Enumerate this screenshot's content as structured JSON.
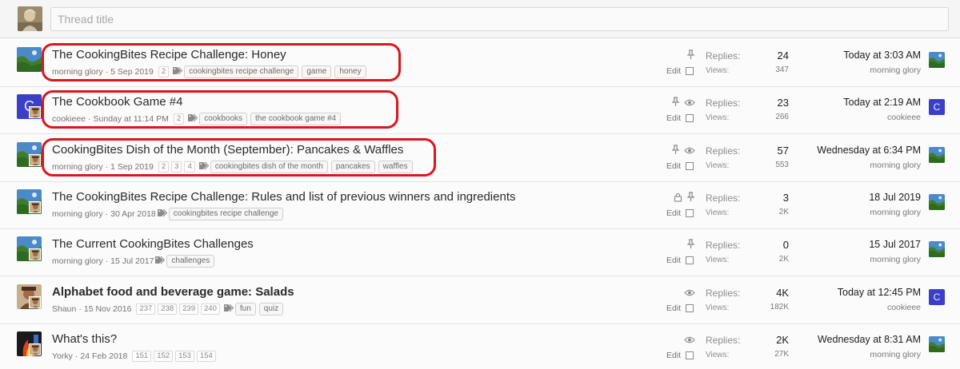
{
  "quick_thread": {
    "placeholder": "Thread title"
  },
  "labels": {
    "replies": "Replies:",
    "views": "Views:",
    "edit": "Edit"
  },
  "colors": {
    "highlight": "#d7181d",
    "avatar_blue": "#3b3fc8"
  },
  "threads": [
    {
      "title": "The CookingBites Recipe Challenge: Honey",
      "author": "morning glory",
      "date": "5 Sep 2019",
      "pages": [
        "2"
      ],
      "tags": [
        "cookingbites recipe challenge",
        "game",
        "honey"
      ],
      "icons": [
        "pin-icon"
      ],
      "replies": "24",
      "views": "347",
      "last_date": "Today at 3:03 AM",
      "last_user": "morning glory",
      "highlighted": true
    },
    {
      "title": "The Cookbook Game #4",
      "author": "cookieee",
      "date": "Sunday at 11:14 PM",
      "pages": [
        "2"
      ],
      "tags": [
        "cookbooks",
        "the cookbook game #4"
      ],
      "icons": [
        "pin-icon",
        "eye-icon"
      ],
      "replies": "23",
      "views": "266",
      "last_date": "Today at 2:19 AM",
      "last_user": "cookieee",
      "avatar_letter": "C",
      "highlighted": true
    },
    {
      "title": "CookingBites Dish of the Month (September): Pancakes & Waffles",
      "author": "morning glory",
      "date": "1 Sep 2019",
      "pages": [
        "2",
        "3",
        "4"
      ],
      "tags": [
        "cookingbites dish of the month",
        "pancakes",
        "waffles"
      ],
      "icons": [
        "pin-icon",
        "eye-icon"
      ],
      "replies": "57",
      "views": "553",
      "last_date": "Wednesday at 6:34 PM",
      "last_user": "morning glory",
      "highlighted": true
    },
    {
      "title": "The CookingBites Recipe Challenge: Rules and list of previous winners and ingredients",
      "author": "morning glory",
      "date": "30 Apr 2018",
      "pages": [],
      "tags": [
        "cookingbites recipe challenge"
      ],
      "icons": [
        "lock-icon",
        "pin-icon"
      ],
      "replies": "3",
      "views": "2K",
      "last_date": "18 Jul 2019",
      "last_user": "morning glory"
    },
    {
      "title": "The Current CookingBites Challenges",
      "author": "morning glory",
      "date": "15 Jul 2017",
      "pages": [],
      "tags": [
        "challenges"
      ],
      "icons": [
        "pin-icon"
      ],
      "replies": "0",
      "views": "2K",
      "last_date": "15 Jul 2017",
      "last_user": "morning glory"
    },
    {
      "title": "Alphabet food and beverage game: Salads",
      "author": "Shaun",
      "date": "15 Nov 2016",
      "pages": [
        "237",
        "238",
        "239",
        "240"
      ],
      "tags": [
        "fun",
        "quiz"
      ],
      "icons": [
        "eye-icon"
      ],
      "replies": "4K",
      "views": "182K",
      "last_date": "Today at 12:45 PM",
      "last_user": "cookieee",
      "last_avatar_letter": "C",
      "unread": true
    },
    {
      "title": "What's this?",
      "author": "Yorky",
      "date": "24 Feb 2018",
      "pages": [
        "151",
        "152",
        "153",
        "154"
      ],
      "tags": [],
      "icons": [
        "eye-icon"
      ],
      "replies": "2K",
      "views": "27K",
      "last_date": "Wednesday at 8:31 AM",
      "last_user": "morning glory"
    }
  ]
}
